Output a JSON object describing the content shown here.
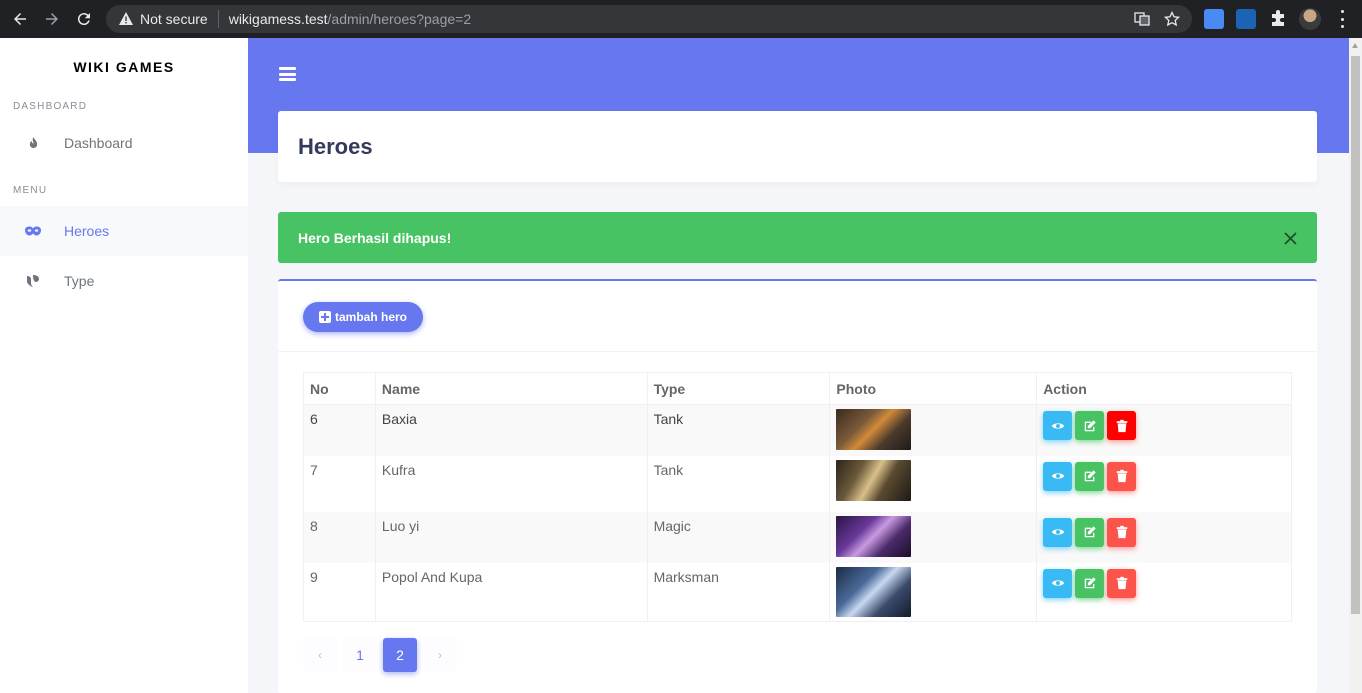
{
  "browser": {
    "not_secure": "Not secure",
    "url_host": "wikigamess.test",
    "url_path": "/admin/heroes?page=2"
  },
  "sidebar": {
    "brand": "WIKI GAMES",
    "sections": [
      {
        "header": "DASHBOARD",
        "items": [
          {
            "label": "Dashboard",
            "icon": "fire-icon"
          }
        ]
      },
      {
        "header": "MENU",
        "items": [
          {
            "label": "Heroes",
            "icon": "mask-icon",
            "active": true
          },
          {
            "label": "Type",
            "icon": "type-icon"
          }
        ]
      }
    ]
  },
  "page": {
    "title": "Heroes",
    "alert": "Hero Berhasil dihapus!",
    "add_button": "tambah hero"
  },
  "table": {
    "headers": [
      "No",
      "Name",
      "Type",
      "Photo",
      "Action"
    ],
    "rows": [
      {
        "no": "6",
        "name": "Baxia",
        "type": "Tank"
      },
      {
        "no": "7",
        "name": "Kufra",
        "type": "Tank"
      },
      {
        "no": "8",
        "name": "Luo yi",
        "type": "Magic"
      },
      {
        "no": "9",
        "name": "Popol And Kupa",
        "type": "Marksman"
      }
    ]
  },
  "pagination": {
    "prev": "‹",
    "pages": [
      "1",
      "2"
    ],
    "next": "›",
    "current": "2"
  },
  "colors": {
    "primary": "#6777ef",
    "success": "#47c363",
    "info": "#3abaf4",
    "danger": "#fc544b"
  }
}
